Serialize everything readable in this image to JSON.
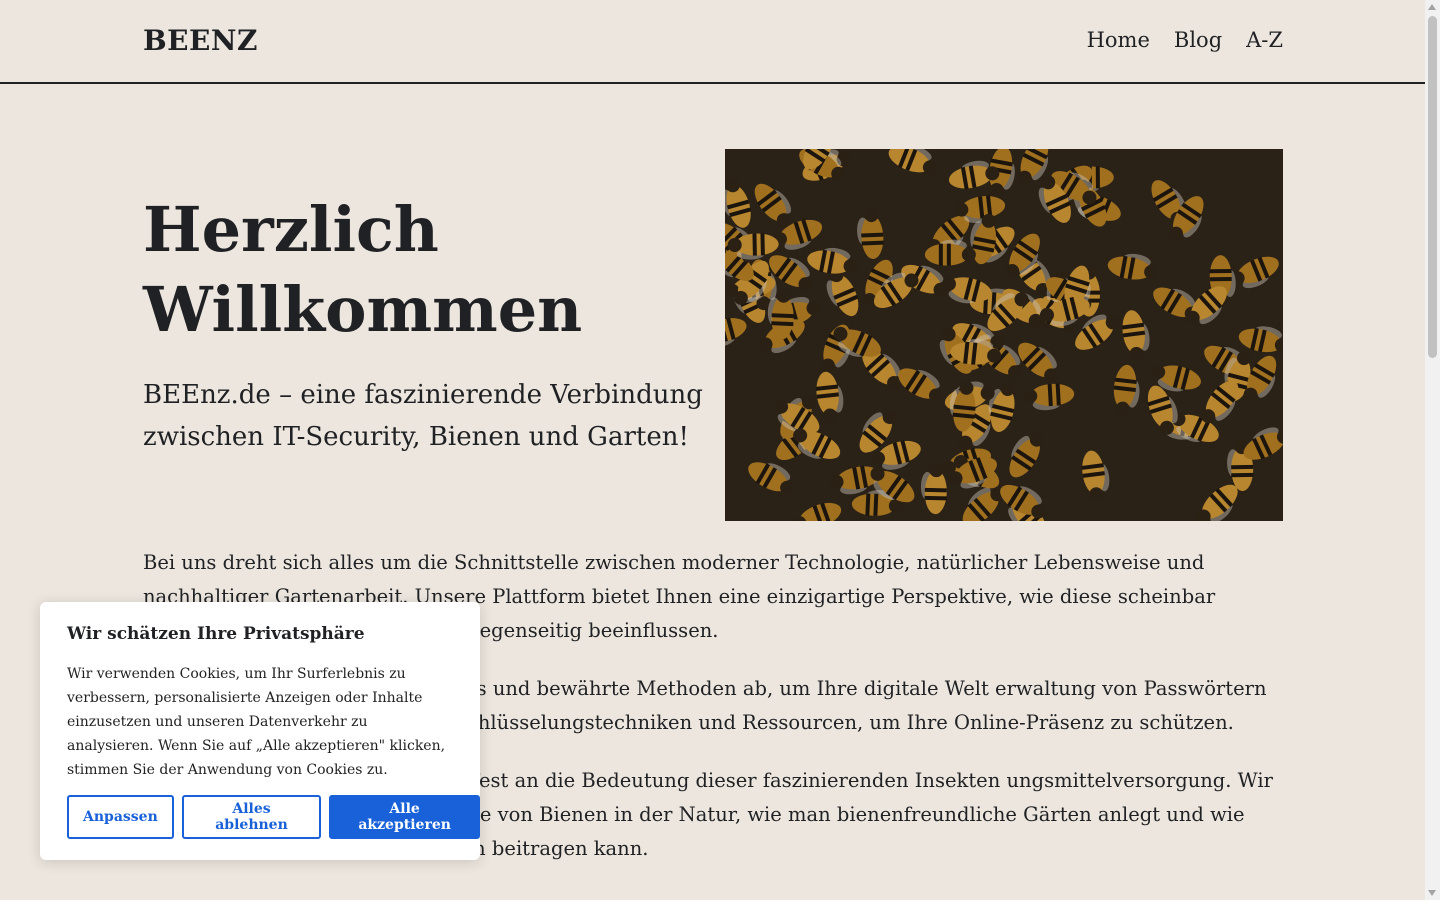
{
  "header": {
    "logo": "BEENZ",
    "nav": [
      "Home",
      "Blog",
      "A-Z"
    ]
  },
  "hero": {
    "title_line1": "Herzlich",
    "title_line2": "Willkommen",
    "subtitle": "BEEnz.de – eine faszinierende Verbindung zwischen IT-Security, Bienen und Garten!",
    "image_alt": "bees-photo"
  },
  "content": {
    "paragraphs": [
      "Bei uns dreht sich alles um die Schnittstelle zwischen moderner Technologie, natürlicher Lebensweise und nachhaltiger Gartenarbeit. Unsere Plattform bietet Ihnen eine einzigartige Perspektive, wie diese scheinbar verschiedenen Bereiche sie sich gegenseitig beeinflussen.",
      "e neuesten Entwicklungen, Trends und bewährte Methoden ab, um Ihre digitale Welt erwaltung von Passwörtern bis hin zu fortgeschrittenen Verschlüsselungstechniken und Ressourcen, um Ihre Online-Präsenz zu schützen.",
      "ne Bienenliebhaber und glauben fest an die Bedeutung dieser faszinierenden Insekten ungsmittelversorgung. Wir teilen Informationen über die Rolle von Bienen in der Natur, wie man bienenfreundliche Gärten anlegt und wie man selbst zum Schutz der Bienen beitragen kann."
    ]
  },
  "cookie_banner": {
    "title": "Wir schätzen Ihre Privatsphäre",
    "text": "Wir verwenden Cookies, um Ihr Surferlebnis zu verbessern, personalisierte Anzeigen oder Inhalte einzusetzen und unseren Datenverkehr zu analysieren. Wenn Sie auf „Alle akzeptieren\" klicken, stimmen Sie der Anwendung von Cookies zu.",
    "buttons": {
      "customize": "Anpassen",
      "reject": "Alles ablehnen",
      "accept": "Alle akzeptieren"
    },
    "accent_color": "#1861d8"
  },
  "colors": {
    "background": "#ece6de",
    "text": "#1f2124"
  }
}
